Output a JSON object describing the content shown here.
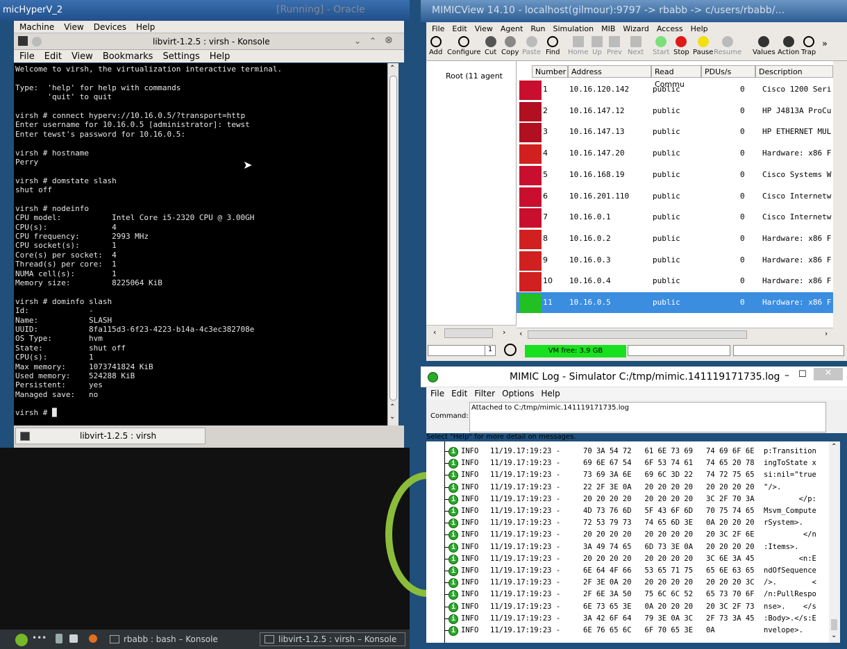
{
  "vm": {
    "title": "micHyperV_2",
    "running": "[Running] - Oracle",
    "menu": [
      "Machine",
      "View",
      "Devices",
      "Help"
    ]
  },
  "konsole": {
    "title": "libvirt-1.2.5 : virsh - Konsole",
    "menu": [
      "File",
      "Edit",
      "View",
      "Bookmarks",
      "Settings",
      "Help"
    ],
    "tab_label": "libvirt-1.2.5 : virsh",
    "terminal_lines": [
      "Welcome to virsh, the virtualization interactive terminal.",
      "",
      "Type:  'help' for help with commands",
      "       'quit' to quit",
      "",
      "virsh # connect hyperv://10.16.0.5/?transport=http",
      "Enter username for 10.16.0.5 [administrator]: tewst",
      "Enter tewst's password for 10.16.0.5:",
      "",
      "virsh # hostname",
      "Perry",
      "",
      "virsh # domstate slash",
      "shut off",
      "",
      "virsh # nodeinfo",
      "CPU model:           Intel Core i5-2320 CPU @ 3.00GH",
      "CPU(s):              4",
      "CPU frequency:       2993 MHz",
      "CPU socket(s):       1",
      "Core(s) per socket:  4",
      "Thread(s) per core:  1",
      "NUMA cell(s):        1",
      "Memory size:         8225064 KiB",
      "",
      "virsh # dominfo slash",
      "Id:             -",
      "Name:           SLASH",
      "UUID:           8fa115d3-6f23-4223-b14a-4c3ec382708e",
      "OS Type:        hvm",
      "State:          shut off",
      "CPU(s):         1",
      "Max memory:     1073741824 KiB",
      "Used memory:    524288 KiB",
      "Persistent:     yes",
      "Managed save:   no",
      "",
      "virsh # █"
    ]
  },
  "taskbar": {
    "task1": "rbabb : bash – Konsole",
    "task2": "libvirt-1.2.5 : virsh – Konsole"
  },
  "mimicview": {
    "title": "MIMICView 14.10 - localhost(gilmour):9797 -> rbabb -> c/users/rbabb/...",
    "menu": [
      "File",
      "Edit",
      "View",
      "Agent",
      "Run",
      "Simulation",
      "MIB",
      "Wizard",
      "Access",
      "Help"
    ],
    "toolbar": [
      "Add",
      "Configure",
      "Cut",
      "Copy",
      "Paste",
      "Find",
      "Home",
      "Up",
      "Prev",
      "Next",
      "Start",
      "Stop",
      "Pause",
      "Resume",
      "Values",
      "Action",
      "Trap"
    ],
    "tree_root": "Root (11 agent",
    "columns": [
      "Number",
      "Address",
      "Read Commu",
      "PDUs/s",
      "Description"
    ],
    "rows": [
      {
        "num": "1",
        "addr": "10.16.120.142",
        "comm": "public",
        "pdus": "0",
        "desc": "Cisco 1200 Seri"
      },
      {
        "num": "2",
        "addr": "10.16.147.12",
        "comm": "public",
        "pdus": "0",
        "desc": "HP J4813A ProCu"
      },
      {
        "num": "3",
        "addr": "10.16.147.13",
        "comm": "public",
        "pdus": "0",
        "desc": "HP ETHERNET MUL"
      },
      {
        "num": "4",
        "addr": "10.16.147.20",
        "comm": "public",
        "pdus": "0",
        "desc": "Hardware: x86 F"
      },
      {
        "num": "5",
        "addr": "10.16.168.19",
        "comm": "public",
        "pdus": "0",
        "desc": "Cisco Systems W"
      },
      {
        "num": "6",
        "addr": "10.16.201.110",
        "comm": "public",
        "pdus": "0",
        "desc": "Cisco Internetw"
      },
      {
        "num": "7",
        "addr": "10.16.0.1",
        "comm": "public",
        "pdus": "0",
        "desc": "Cisco Internetw"
      },
      {
        "num": "8",
        "addr": "10.16.0.2",
        "comm": "public",
        "pdus": "0",
        "desc": "Hardware: x86 F"
      },
      {
        "num": "9",
        "addr": "10.16.0.3",
        "comm": "public",
        "pdus": "0",
        "desc": "Hardware: x86 F"
      },
      {
        "num": "10",
        "addr": "10.16.0.4",
        "comm": "public",
        "pdus": "0",
        "desc": "Hardware: x86 F"
      },
      {
        "num": "11",
        "addr": "10.16.0.5",
        "comm": "public",
        "pdus": "0",
        "desc": "Hardware: x86 F"
      }
    ],
    "status_page": "1",
    "vm_free": "VM free: 3.9 GB"
  },
  "mimiclog": {
    "title": "MIMIC Log - Simulator C:/tmp/mimic.141119171735.log",
    "menu": [
      "File",
      "Edit",
      "Filter",
      "Options",
      "Help"
    ],
    "command_label": "Command:",
    "command_text": "Attached to C:/tmp/mimic.141119171735.log",
    "help_text": "Select \"Help\" for more detail on messages.",
    "level": "INFO",
    "time": "11/19.17:19:23 -",
    "rows": [
      {
        "hex": "70 3A 54 72   61 6E 73 69   74 69 6F 6E",
        "text": "p:Transition"
      },
      {
        "hex": "69 6E 67 54   6F 53 74 61   74 65 20 78",
        "text": "ingToState x"
      },
      {
        "hex": "73 69 3A 6E   69 6C 3D 22   74 72 75 65",
        "text": "si:nil=\"true"
      },
      {
        "hex": "22 2F 3E 0A   20 20 20 20   20 20 20 20",
        "text": "\"/>."
      },
      {
        "hex": "20 20 20 20   20 20 20 20   3C 2F 70 3A",
        "text": "        </p:"
      },
      {
        "hex": "4D 73 76 6D   5F 43 6F 6D   70 75 74 65",
        "text": "Msvm_Compute"
      },
      {
        "hex": "72 53 79 73   74 65 6D 3E   0A 20 20 20",
        "text": "rSystem>."
      },
      {
        "hex": "20 20 20 20   20 20 20 20   20 3C 2F 6E",
        "text": "         </n"
      },
      {
        "hex": "3A 49 74 65   6D 73 3E 0A   20 20 20 20",
        "text": ":Items>."
      },
      {
        "hex": "20 20 20 20   20 20 20 20   3C 6E 3A 45",
        "text": "        <n:E"
      },
      {
        "hex": "6E 64 4F 66   53 65 71 75   65 6E 63 65",
        "text": "ndOfSequence"
      },
      {
        "hex": "2F 3E 0A 20   20 20 20 20   20 20 20 3C",
        "text": "/>.        <"
      },
      {
        "hex": "2F 6E 3A 50   75 6C 6C 52   65 73 70 6F",
        "text": "/n:PullRespo"
      },
      {
        "hex": "6E 73 65 3E   0A 20 20 20   20 3C 2F 73",
        "text": "nse>.    </s"
      },
      {
        "hex": "3A 42 6F 64   79 3E 0A 3C   2F 73 3A 45",
        "text": ":Body>.</s:E"
      },
      {
        "hex": "6E 76 65 6C   6F 70 65 3E   0A",
        "text": "nvelope>."
      }
    ]
  },
  "colors": {
    "selected_row": "#3b8de0",
    "vm_free": "#18e01f",
    "info_icon": "#2aaa2a"
  }
}
